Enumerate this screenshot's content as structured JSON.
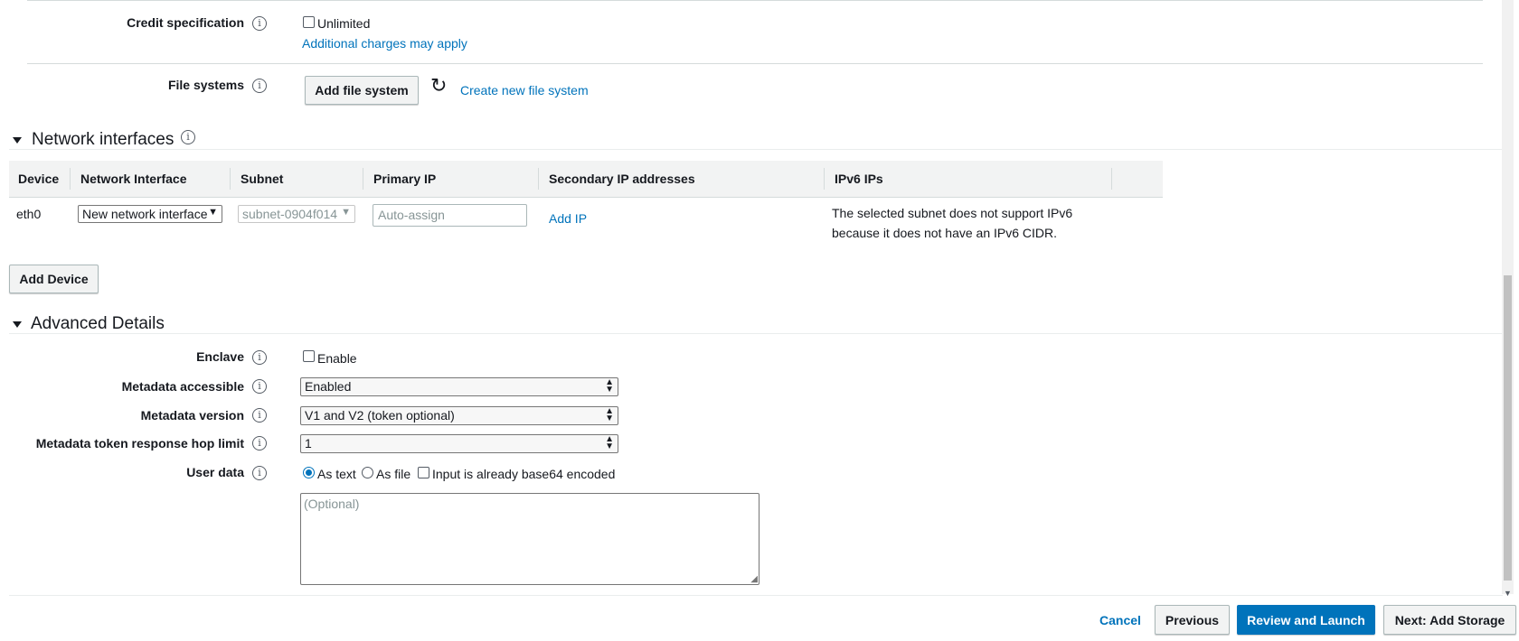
{
  "credit": {
    "label": "Credit specification",
    "checkbox_label": "Unlimited",
    "note_link": "Additional charges may apply"
  },
  "file_systems": {
    "label": "File systems",
    "add_button": "Add file system",
    "create_link": "Create new file system"
  },
  "network": {
    "title": "Network interfaces",
    "columns": [
      "Device",
      "Network Interface",
      "Subnet",
      "Primary IP",
      "Secondary IP addresses",
      "IPv6 IPs"
    ],
    "row": {
      "device": "eth0",
      "interface": "New network interface",
      "subnet": "subnet-0904f014",
      "primary_ip_placeholder": "Auto-assign",
      "add_ip": "Add IP",
      "ipv6_line1": "The selected subnet does not support IPv6",
      "ipv6_line2": "because it does not have an IPv6 CIDR."
    },
    "add_device": "Add Device"
  },
  "advanced": {
    "title": "Advanced Details",
    "enclave_label": "Enclave",
    "enclave_checkbox": "Enable",
    "metadata_accessible_label": "Metadata accessible",
    "metadata_accessible_value": "Enabled",
    "metadata_version_label": "Metadata version",
    "metadata_version_value": "V1 and V2 (token optional)",
    "hop_limit_label": "Metadata token response hop limit",
    "hop_limit_value": "1",
    "user_data_label": "User data",
    "as_text": "As text",
    "as_file": "As file",
    "base64": "Input is already base64 encoded",
    "user_data_placeholder": "(Optional)"
  },
  "footer": {
    "cancel": "Cancel",
    "previous": "Previous",
    "review": "Review and Launch",
    "next": "Next: Add Storage"
  },
  "colors": {
    "accent": "#0073bb",
    "border": "#d5dbdb",
    "header_bg": "#f2f3f3"
  }
}
